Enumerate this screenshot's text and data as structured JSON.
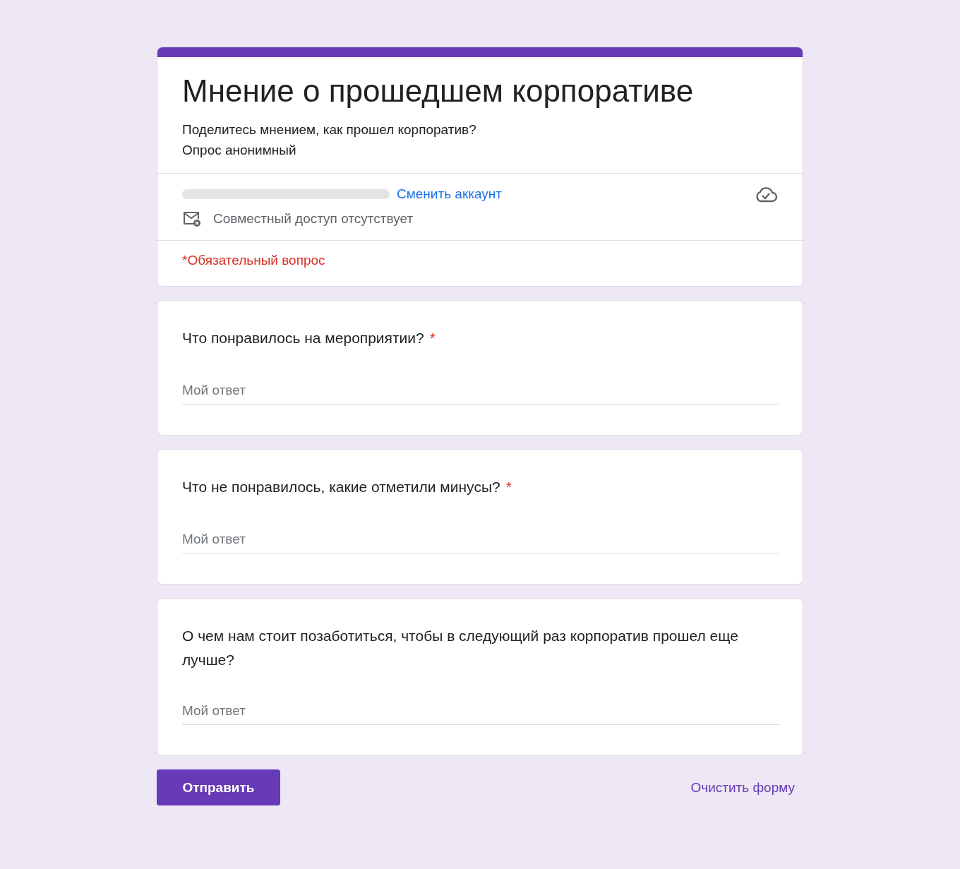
{
  "form": {
    "title": "Мнение о прошедшем корпоративе",
    "description": [
      "Поделитесь мнением, как прошел корпоратив?",
      "Опрос анонимный"
    ],
    "account": {
      "switch_link": "Сменить аккаунт",
      "sharing_status": "Совместный доступ отсутствует"
    },
    "required_notice": "*Обязательный вопрос"
  },
  "questions": [
    {
      "text": "Что понравилось на мероприятии?",
      "mark": "*",
      "placeholder": "Мой ответ"
    },
    {
      "text": "Что не понравилось, какие отметили минусы?",
      "mark": "*",
      "placeholder": "Мой ответ"
    },
    {
      "text": "О чем нам стоит позаботиться, чтобы в следующий раз корпоратив прошел еще лучше?",
      "placeholder": "Мой ответ"
    }
  ],
  "actions": {
    "submit": "Отправить",
    "clear": "Очистить форму"
  }
}
